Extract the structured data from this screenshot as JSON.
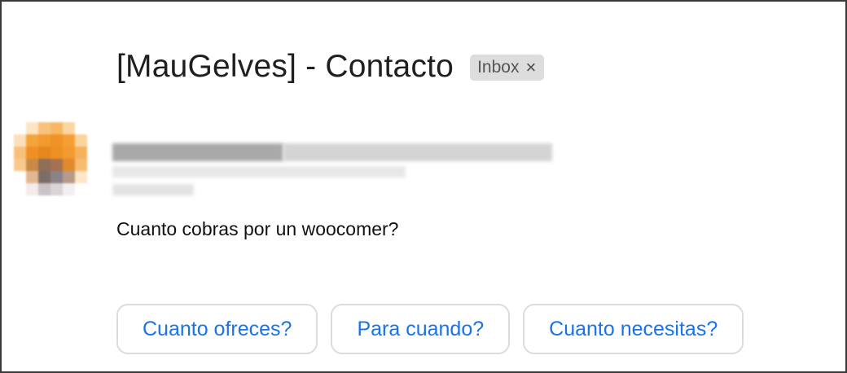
{
  "email": {
    "subject": "[MauGelves] - Contacto",
    "label": {
      "text": "Inbox",
      "close_glyph": "×"
    },
    "message": "Cuanto cobras por un woocomer?"
  },
  "smart_replies": [
    {
      "label": "Cuanto ofreces?"
    },
    {
      "label": "Para cuando?"
    },
    {
      "label": "Cuanto necesitas?"
    }
  ],
  "colors": {
    "reply_text": "#1a73e8",
    "label_chip_bg": "#dddddd",
    "avatar_accent": "#f29a2e"
  }
}
